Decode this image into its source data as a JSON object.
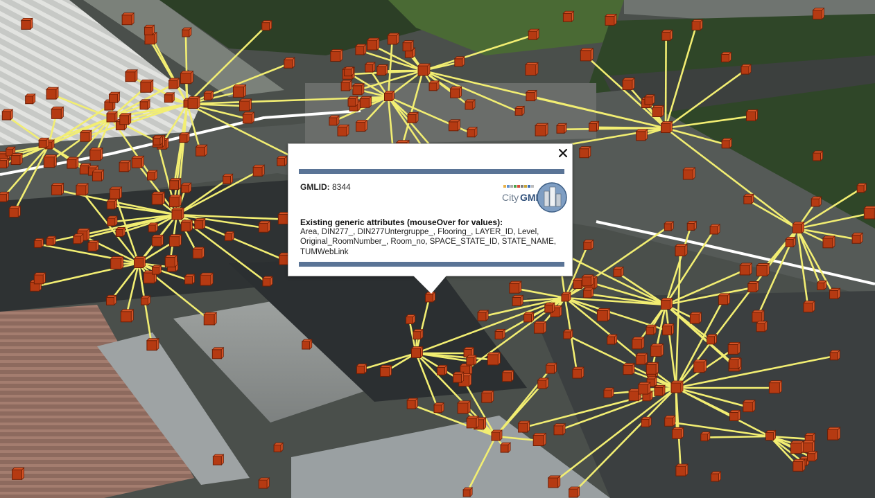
{
  "popup": {
    "gmlid_label": "GMLID:",
    "gmlid_value": "8344",
    "attributes_heading": "Existing generic attributes (mouseOver for values):",
    "attributes_list": "Area, DIN277_, DIN277Untergruppe_, Flooring_, LAYER_ID, Level, Original_RoomNumber_, Room_no, SPACE_STATE_ID, STATE_NAME, TUMWebLink",
    "logo_text_city": "City",
    "logo_text_gml": "GML"
  },
  "colors": {
    "link_line": "#f2ee72",
    "marker_fill": "#b53a12",
    "popup_rule": "#5a7496",
    "road_line": "#ffffff"
  },
  "icons": [
    "close-icon",
    "citygml-logo",
    "room-marker-icon"
  ]
}
